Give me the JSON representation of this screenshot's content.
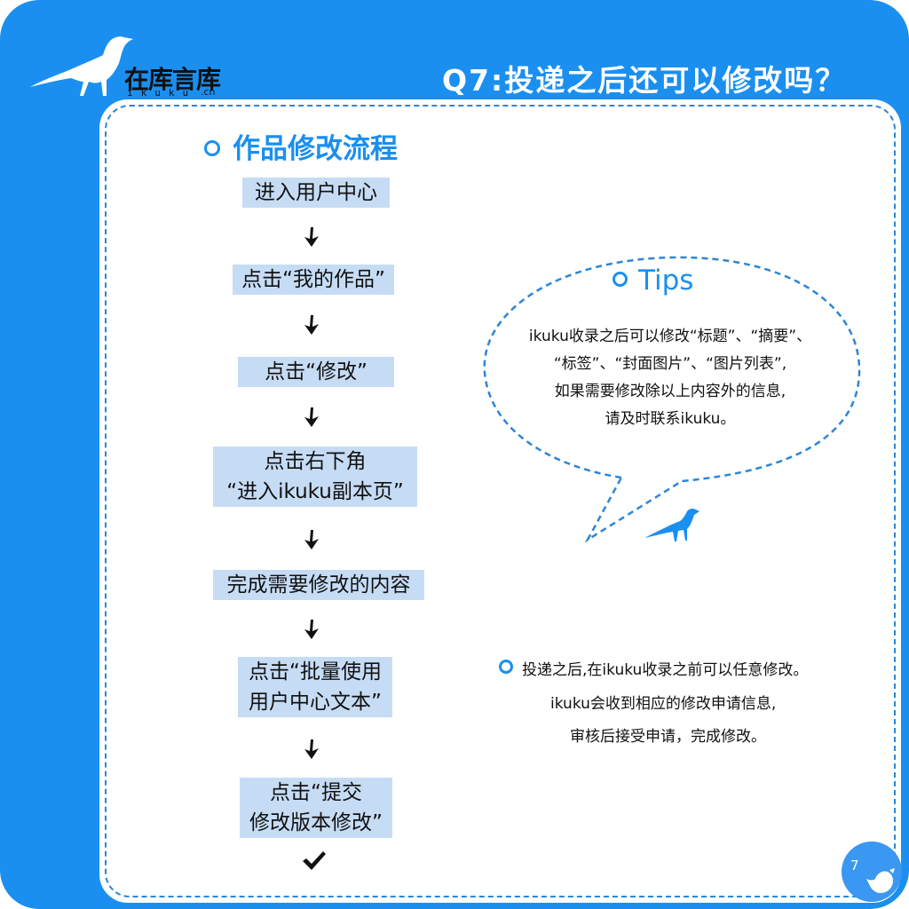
{
  "brand": {
    "logo_text": "在库言库",
    "logo_sub_letters": "ikuku",
    "logo_sub_cn": ".cn"
  },
  "header": {
    "question_title": "Q7:投递之后还可以修改吗？"
  },
  "flow": {
    "title": "作品修改流程",
    "steps": [
      {
        "lines": [
          "进入用户中心"
        ]
      },
      {
        "lines": [
          "点击“我的作品”"
        ]
      },
      {
        "lines": [
          "点击“修改”"
        ]
      },
      {
        "lines": [
          "点击右下角",
          "“进入ikuku副本页”"
        ]
      },
      {
        "lines": [
          "完成需要修改的内容"
        ]
      },
      {
        "lines": [
          "点击“批量使用",
          "用户中心文本”"
        ]
      },
      {
        "lines": [
          "点击“提交",
          "修改版本修改”"
        ]
      }
    ]
  },
  "tips": {
    "title": "Tips",
    "lines": [
      "ikuku收录之后可以修改“标题”、“摘要”、",
      "“标签”、“封面图片”、“图片列表”,",
      "如果需要修改除以上内容外的信息,",
      "请及时联系ikuku。"
    ]
  },
  "note": {
    "lines": [
      "投递之后,在ikuku收录之前可以任意修改。",
      "ikuku会收到相应的修改申请信息,",
      "审核后接受申请，完成修改。"
    ]
  },
  "page": {
    "number": "7"
  },
  "colors": {
    "brand_blue": "#1a8ff0",
    "step_highlight": "#c6dcf5"
  },
  "icons": [
    "bird-logo-icon",
    "down-arrow-icon",
    "check-icon",
    "bird-icon",
    "ring-bullet-icon"
  ]
}
